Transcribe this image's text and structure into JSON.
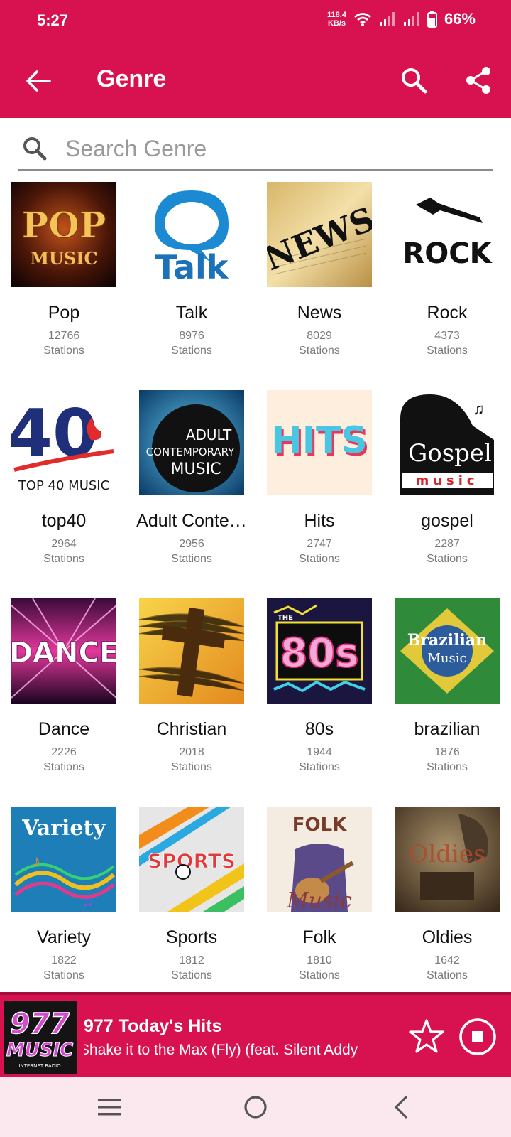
{
  "status_bar": {
    "time": "5:27",
    "net_speed_value": "118.4",
    "net_speed_unit": "KB/s",
    "battery": "66%"
  },
  "app_bar": {
    "title": "Genre",
    "icons": [
      "back-arrow-icon",
      "search-icon",
      "share-icon"
    ]
  },
  "search": {
    "placeholder": "Search Genre",
    "value": ""
  },
  "genres": [
    {
      "name": "Pop",
      "count": "12766",
      "unit": "Stations",
      "art_text": [
        "POP",
        "MUSIC"
      ]
    },
    {
      "name": "Talk",
      "count": "8976",
      "unit": "Stations",
      "art_text": [
        "Talk"
      ]
    },
    {
      "name": "News",
      "count": "8029",
      "unit": "Stations",
      "art_text": [
        "NEWS"
      ]
    },
    {
      "name": "Rock",
      "count": "4373",
      "unit": "Stations",
      "art_text": [
        "ROCK"
      ]
    },
    {
      "name": "top40",
      "count": "2964",
      "unit": "Stations",
      "art_text": [
        "40",
        "TOP 40 MUSIC"
      ]
    },
    {
      "name": "Adult Conte…",
      "count": "2956",
      "unit": "Stations",
      "art_text": [
        "ADULT",
        "CONTEMPORARY",
        "MUSIC"
      ]
    },
    {
      "name": "Hits",
      "count": "2747",
      "unit": "Stations",
      "art_text": [
        "HITS"
      ]
    },
    {
      "name": "gospel",
      "count": "2287",
      "unit": "Stations",
      "art_text": [
        "Gospel",
        "music"
      ]
    },
    {
      "name": "Dance",
      "count": "2226",
      "unit": "Stations",
      "art_text": [
        "DANCE"
      ]
    },
    {
      "name": "Christian",
      "count": "2018",
      "unit": "Stations",
      "art_text": []
    },
    {
      "name": "80s",
      "count": "1944",
      "unit": "Stations",
      "art_text": [
        "80s",
        "THE"
      ]
    },
    {
      "name": "brazilian",
      "count": "1876",
      "unit": "Stations",
      "art_text": [
        "Brazilian",
        "Music"
      ]
    },
    {
      "name": "Variety",
      "count": "1822",
      "unit": "Stations",
      "art_text": [
        "Variety"
      ]
    },
    {
      "name": "Sports",
      "count": "1812",
      "unit": "Stations",
      "art_text": [
        "SPORTS"
      ]
    },
    {
      "name": "Folk",
      "count": "1810",
      "unit": "Stations",
      "art_text": [
        "FOLK",
        "Music"
      ]
    },
    {
      "name": "Oldies",
      "count": "1642",
      "unit": "Stations",
      "art_text": [
        "Oldies"
      ]
    }
  ],
  "player": {
    "station": "977 Today's Hits",
    "track": "Shake it to the Max (Fly) (feat. Silent Addy",
    "logo_text": [
      "977",
      "MUSIC",
      "INTERNET RADIO"
    ]
  },
  "colors": {
    "primary": "#d81250",
    "nav_bar_bg": "#fbe7ee",
    "text_secondary": "#7a7a7a"
  }
}
